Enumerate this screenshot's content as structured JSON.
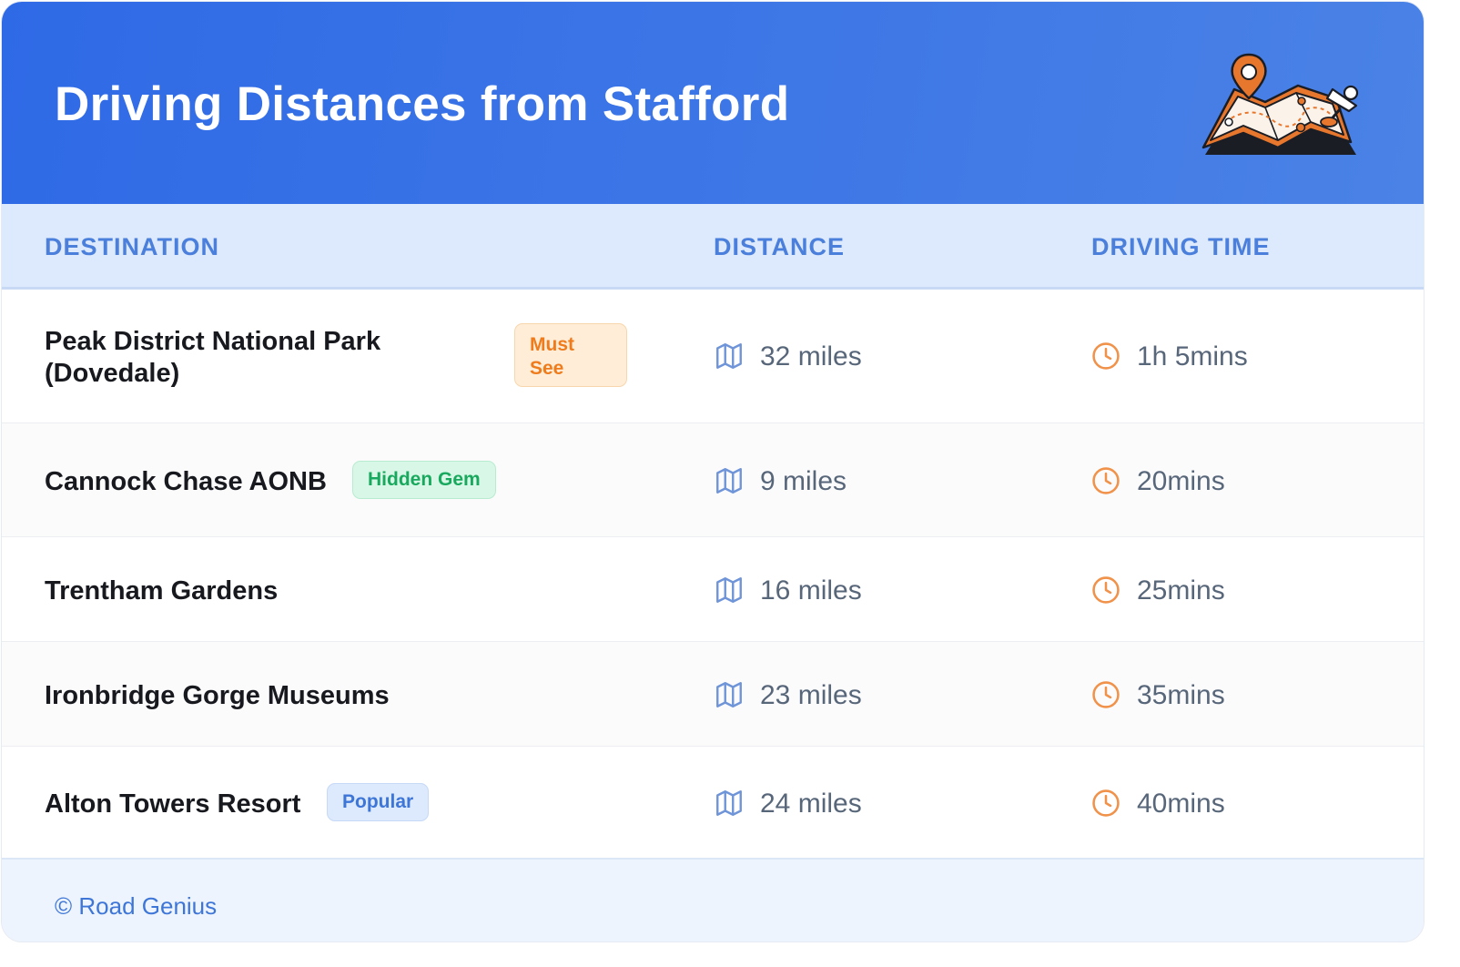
{
  "header": {
    "title": "Driving Distances from Stafford",
    "illustration": "map-with-location-pin-icon",
    "colors": {
      "gradient_start": "#2f6ae6",
      "gradient_end": "#4a82e6"
    }
  },
  "columns": {
    "destination": "DESTINATION",
    "distance": "DISTANCE",
    "driving_time": "DRIVING TIME"
  },
  "rows": [
    {
      "destination_line1": "Peak District National Park",
      "destination_line2": "(Dovedale)",
      "badge_line1": "Must",
      "badge_line2": "See",
      "distance": "32 miles",
      "time": "1h 5mins"
    },
    {
      "destination": "Cannock Chase AONB",
      "badge": "Hidden Gem",
      "distance": "9 miles",
      "time": "20mins"
    },
    {
      "destination": "Trentham Gardens",
      "distance": "16 miles",
      "time": "25mins"
    },
    {
      "destination": "Ironbridge Gorge Museums",
      "distance": "23 miles",
      "time": "35mins"
    },
    {
      "destination": "Alton Towers Resort",
      "badge": "Popular",
      "distance": "24 miles",
      "time": "40mins"
    }
  ],
  "icons": {
    "distance": "map-icon",
    "time": "clock-icon"
  },
  "footer": {
    "credit": "© Road Genius"
  },
  "colors": {
    "accent": "#4a7fdc",
    "must_see": "#ef7c1c",
    "hidden_gem": "#19a95e",
    "popular": "#3e76d8",
    "clock": "#f0924a"
  }
}
